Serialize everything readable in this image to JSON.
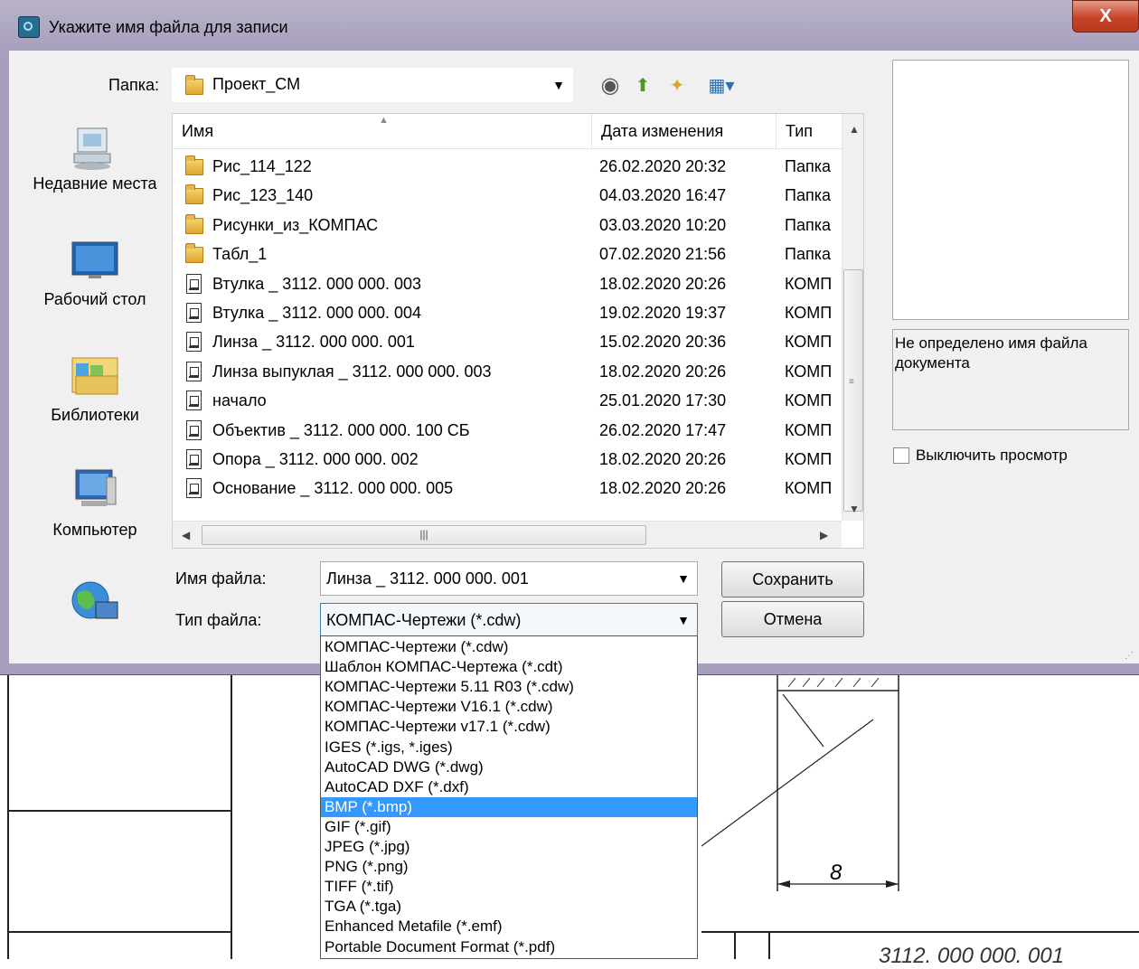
{
  "window": {
    "title": "Укажите имя файла для записи",
    "close_label": "X"
  },
  "folder": {
    "label": "Папка:",
    "value": "Проект_СМ"
  },
  "places": [
    {
      "label": "Недавние места",
      "icon": "recent-places-icon"
    },
    {
      "label": "Рабочий стол",
      "icon": "desktop-icon"
    },
    {
      "label": "Библиотеки",
      "icon": "libraries-icon"
    },
    {
      "label": "Компьютер",
      "icon": "computer-icon"
    },
    {
      "label": "",
      "icon": "network-icon"
    }
  ],
  "columns": [
    "Имя",
    "Дата изменения",
    "Тип"
  ],
  "files": [
    {
      "name": "Рис_114_122",
      "date": "26.02.2020 20:32",
      "type": "Папка",
      "kind": "folder"
    },
    {
      "name": "Рис_123_140",
      "date": "04.03.2020 16:47",
      "type": "Папка",
      "kind": "folder"
    },
    {
      "name": "Рисунки_из_КОМПАС",
      "date": "03.03.2020 10:20",
      "type": "Папка",
      "kind": "folder"
    },
    {
      "name": "Табл_1",
      "date": "07.02.2020 21:56",
      "type": "Папка",
      "kind": "folder"
    },
    {
      "name": "Втулка _ 3112. 000 000. 003",
      "date": "18.02.2020 20:26",
      "type": "КОМП",
      "kind": "doc"
    },
    {
      "name": "Втулка _ 3112. 000 000. 004",
      "date": "19.02.2020 19:37",
      "type": "КОМП",
      "kind": "doc"
    },
    {
      "name": "Линза _ 3112. 000 000. 001",
      "date": "15.02.2020 20:36",
      "type": "КОМП",
      "kind": "doc"
    },
    {
      "name": "Линза выпуклая _ 3112. 000 000. 003",
      "date": "18.02.2020 20:26",
      "type": "КОМП",
      "kind": "doc"
    },
    {
      "name": "начало",
      "date": "25.01.2020 17:30",
      "type": "КОМП",
      "kind": "doc"
    },
    {
      "name": "Объектив _ 3112. 000 000. 100 СБ",
      "date": "26.02.2020 17:47",
      "type": "КОМП",
      "kind": "doc"
    },
    {
      "name": "Опора _ 3112. 000 000. 002",
      "date": "18.02.2020 20:26",
      "type": "КОМП",
      "kind": "doc"
    },
    {
      "name": "Основание _ 3112. 000 000. 005",
      "date": "18.02.2020 20:26",
      "type": "КОМП",
      "kind": "doc"
    }
  ],
  "filename": {
    "label": "Имя файла:",
    "value": "Линза _ 3112. 000 000. 001"
  },
  "filetype": {
    "label": "Тип файла:",
    "value": "КОМПАС-Чертежи (*.cdw)",
    "options": [
      "КОМПАС-Чертежи (*.cdw)",
      "Шаблон КОМПАС-Чертежа (*.cdt)",
      "КОМПАС-Чертежи 5.11 R03 (*.cdw)",
      "КОМПАС-Чертежи V16.1 (*.cdw)",
      "КОМПАС-Чертежи v17.1 (*.cdw)",
      "IGES (*.igs, *.iges)",
      "AutoCAD DWG (*.dwg)",
      "AutoCAD DXF (*.dxf)",
      "BMP (*.bmp)",
      "GIF (*.gif)",
      "JPEG (*.jpg)",
      "PNG (*.png)",
      "TIFF (*.tif)",
      "TGA (*.tga)",
      "Enhanced Metafile (*.emf)",
      "Portable Document Format (*.pdf)"
    ],
    "selected_option": "BMP (*.bmp)"
  },
  "buttons": {
    "save": "Сохранить",
    "cancel": "Отмена"
  },
  "preview": {
    "status": "Не определено имя файла документа",
    "disable_label": "Выключить просмотр"
  },
  "background": {
    "dimension": "8",
    "stamp": "3112. 000 000. 001"
  },
  "colors": {
    "selection": "#3399ff",
    "titlebar": "#a79fbd",
    "close": "#c5452b"
  }
}
